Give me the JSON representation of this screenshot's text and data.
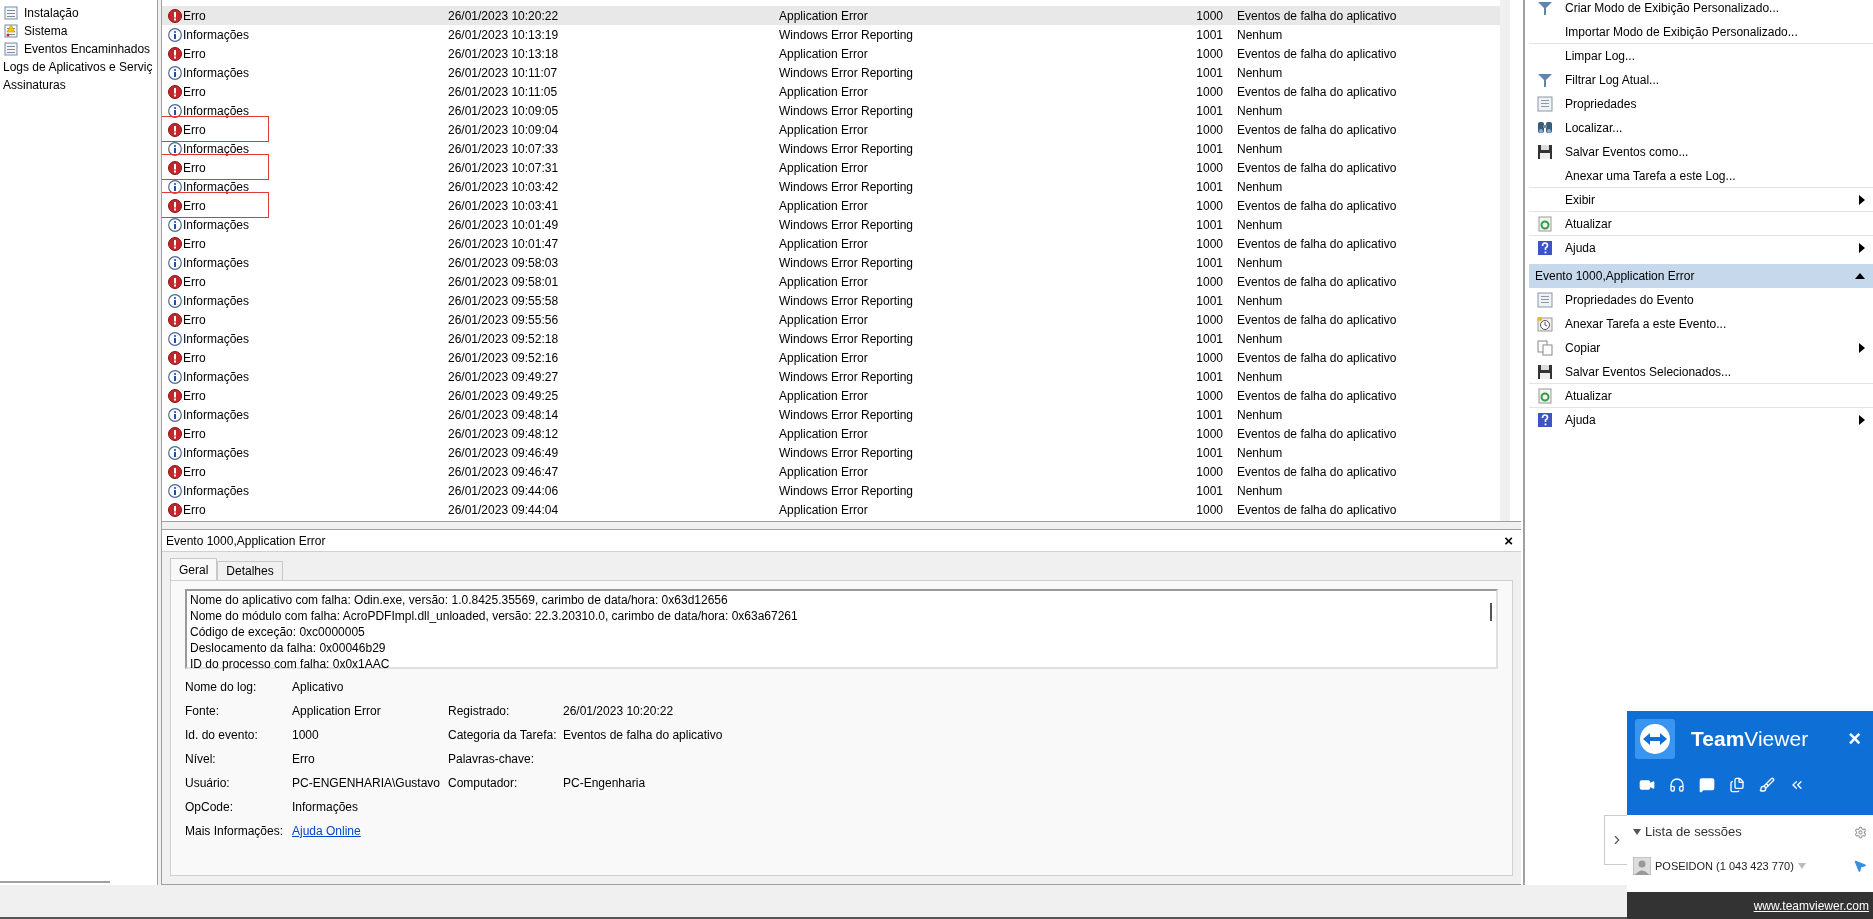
{
  "sidebar": {
    "log_items": [
      {
        "label": "Instalação",
        "kind": "log"
      },
      {
        "label": "Sistema",
        "kind": "warning_log"
      },
      {
        "label": "Eventos Encaminhados",
        "kind": "log"
      }
    ],
    "items": [
      {
        "label": "Logs de Aplicativos e Serviç"
      },
      {
        "label": "Assinaturas"
      }
    ]
  },
  "events": {
    "rows": [
      {
        "kind": "error",
        "level": "Erro",
        "date": "26/01/2023 10:20:22",
        "source": "Application Error",
        "id": "1000",
        "category": "Eventos de falha do aplicativo",
        "selected": true,
        "highlighted": false
      },
      {
        "kind": "info",
        "level": "Informações",
        "date": "26/01/2023 10:13:19",
        "source": "Windows Error Reporting",
        "id": "1001",
        "category": "Nenhum",
        "selected": false,
        "highlighted": false
      },
      {
        "kind": "error",
        "level": "Erro",
        "date": "26/01/2023 10:13:18",
        "source": "Application Error",
        "id": "1000",
        "category": "Eventos de falha do aplicativo",
        "selected": false,
        "highlighted": false
      },
      {
        "kind": "info",
        "level": "Informações",
        "date": "26/01/2023 10:11:07",
        "source": "Windows Error Reporting",
        "id": "1001",
        "category": "Nenhum",
        "selected": false,
        "highlighted": false
      },
      {
        "kind": "error",
        "level": "Erro",
        "date": "26/01/2023 10:11:05",
        "source": "Application Error",
        "id": "1000",
        "category": "Eventos de falha do aplicativo",
        "selected": false,
        "highlighted": false
      },
      {
        "kind": "info",
        "level": "Informações",
        "date": "26/01/2023 10:09:05",
        "source": "Windows Error Reporting",
        "id": "1001",
        "category": "Nenhum",
        "selected": false,
        "highlighted": false
      },
      {
        "kind": "error",
        "level": "Erro",
        "date": "26/01/2023 10:09:04",
        "source": "Application Error",
        "id": "1000",
        "category": "Eventos de falha do aplicativo",
        "selected": false,
        "highlighted": true
      },
      {
        "kind": "info",
        "level": "Informações",
        "date": "26/01/2023 10:07:33",
        "source": "Windows Error Reporting",
        "id": "1001",
        "category": "Nenhum",
        "selected": false,
        "highlighted": false
      },
      {
        "kind": "error",
        "level": "Erro",
        "date": "26/01/2023 10:07:31",
        "source": "Application Error",
        "id": "1000",
        "category": "Eventos de falha do aplicativo",
        "selected": false,
        "highlighted": true
      },
      {
        "kind": "info",
        "level": "Informações",
        "date": "26/01/2023 10:03:42",
        "source": "Windows Error Reporting",
        "id": "1001",
        "category": "Nenhum",
        "selected": false,
        "highlighted": false
      },
      {
        "kind": "error",
        "level": "Erro",
        "date": "26/01/2023 10:03:41",
        "source": "Application Error",
        "id": "1000",
        "category": "Eventos de falha do aplicativo",
        "selected": false,
        "highlighted": true
      },
      {
        "kind": "info",
        "level": "Informações",
        "date": "26/01/2023 10:01:49",
        "source": "Windows Error Reporting",
        "id": "1001",
        "category": "Nenhum",
        "selected": false,
        "highlighted": false
      },
      {
        "kind": "error",
        "level": "Erro",
        "date": "26/01/2023 10:01:47",
        "source": "Application Error",
        "id": "1000",
        "category": "Eventos de falha do aplicativo",
        "selected": false,
        "highlighted": false
      },
      {
        "kind": "info",
        "level": "Informações",
        "date": "26/01/2023 09:58:03",
        "source": "Windows Error Reporting",
        "id": "1001",
        "category": "Nenhum",
        "selected": false,
        "highlighted": false
      },
      {
        "kind": "error",
        "level": "Erro",
        "date": "26/01/2023 09:58:01",
        "source": "Application Error",
        "id": "1000",
        "category": "Eventos de falha do aplicativo",
        "selected": false,
        "highlighted": false
      },
      {
        "kind": "info",
        "level": "Informações",
        "date": "26/01/2023 09:55:58",
        "source": "Windows Error Reporting",
        "id": "1001",
        "category": "Nenhum",
        "selected": false,
        "highlighted": false
      },
      {
        "kind": "error",
        "level": "Erro",
        "date": "26/01/2023 09:55:56",
        "source": "Application Error",
        "id": "1000",
        "category": "Eventos de falha do aplicativo",
        "selected": false,
        "highlighted": false
      },
      {
        "kind": "info",
        "level": "Informações",
        "date": "26/01/2023 09:52:18",
        "source": "Windows Error Reporting",
        "id": "1001",
        "category": "Nenhum",
        "selected": false,
        "highlighted": false
      },
      {
        "kind": "error",
        "level": "Erro",
        "date": "26/01/2023 09:52:16",
        "source": "Application Error",
        "id": "1000",
        "category": "Eventos de falha do aplicativo",
        "selected": false,
        "highlighted": false
      },
      {
        "kind": "info",
        "level": "Informações",
        "date": "26/01/2023 09:49:27",
        "source": "Windows Error Reporting",
        "id": "1001",
        "category": "Nenhum",
        "selected": false,
        "highlighted": false
      },
      {
        "kind": "error",
        "level": "Erro",
        "date": "26/01/2023 09:49:25",
        "source": "Application Error",
        "id": "1000",
        "category": "Eventos de falha do aplicativo",
        "selected": false,
        "highlighted": false
      },
      {
        "kind": "info",
        "level": "Informações",
        "date": "26/01/2023 09:48:14",
        "source": "Windows Error Reporting",
        "id": "1001",
        "category": "Nenhum",
        "selected": false,
        "highlighted": false
      },
      {
        "kind": "error",
        "level": "Erro",
        "date": "26/01/2023 09:48:12",
        "source": "Application Error",
        "id": "1000",
        "category": "Eventos de falha do aplicativo",
        "selected": false,
        "highlighted": false
      },
      {
        "kind": "info",
        "level": "Informações",
        "date": "26/01/2023 09:46:49",
        "source": "Windows Error Reporting",
        "id": "1001",
        "category": "Nenhum",
        "selected": false,
        "highlighted": false
      },
      {
        "kind": "error",
        "level": "Erro",
        "date": "26/01/2023 09:46:47",
        "source": "Application Error",
        "id": "1000",
        "category": "Eventos de falha do aplicativo",
        "selected": false,
        "highlighted": false
      },
      {
        "kind": "info",
        "level": "Informações",
        "date": "26/01/2023 09:44:06",
        "source": "Windows Error Reporting",
        "id": "1001",
        "category": "Nenhum",
        "selected": false,
        "highlighted": false
      },
      {
        "kind": "error",
        "level": "Erro",
        "date": "26/01/2023 09:44:04",
        "source": "Application Error",
        "id": "1000",
        "category": "Eventos de falha do aplicativo",
        "selected": false,
        "highlighted": false
      }
    ]
  },
  "details": {
    "title": "Evento 1000,Application Error",
    "close": "×",
    "tabs": [
      {
        "label": "Geral",
        "selected": true
      },
      {
        "label": "Detalhes",
        "selected": false
      }
    ],
    "description": [
      "Nome do aplicativo com falha: Odin.exe, versão: 1.0.8425.35569, carimbo de data/hora: 0x63d12656",
      "Nome do módulo com falha: AcroPDFImpl.dll_unloaded, versão: 22.3.20310.0, carimbo de data/hora: 0x63a67261",
      "Código de exceção: 0xc0000005",
      "Deslocamento da falha: 0x00046b29",
      "ID do processo com falha: 0x0x1AAC"
    ],
    "fields": [
      {
        "label": "Nome do log:",
        "value": "Aplicativo"
      },
      {
        "label": "Fonte:",
        "value": "Application Error",
        "label2": "Registrado:",
        "value2": "26/01/2023 10:20:22"
      },
      {
        "label": "Id. do evento:",
        "value": "1000",
        "label2": "Categoria da Tarefa:",
        "value2": "Eventos de falha do aplicativo"
      },
      {
        "label": "Nível:",
        "value": "Erro",
        "label2": "Palavras-chave:"
      },
      {
        "label": "Usuário:",
        "value": "PC-ENGENHARIA\\Gustavo",
        "label2": "Computador:",
        "value2": "PC-Engenharia"
      },
      {
        "label": "OpCode:",
        "value": "Informações"
      },
      {
        "label": "Mais Informações:",
        "link": "Ajuda Online"
      }
    ]
  },
  "actions": {
    "items": [
      {
        "label": "Criar Modo de Exibição Personalizado...",
        "submenu": false
      },
      {
        "label": "Importar Modo de Exibição Personalizado...",
        "submenu": false
      },
      {
        "label": "Limpar Log...",
        "submenu": false
      },
      {
        "label": "Filtrar Log Atual...",
        "submenu": false
      },
      {
        "label": "Propriedades",
        "submenu": false
      },
      {
        "label": "Localizar...",
        "submenu": false
      },
      {
        "label": "Salvar Eventos como...",
        "submenu": false
      },
      {
        "label": "Anexar uma Tarefa a este Log...",
        "submenu": false
      },
      {
        "label": "Exibir",
        "submenu": true
      },
      {
        "label": "Atualizar",
        "submenu": false
      },
      {
        "label": "Ajuda",
        "submenu": true
      }
    ],
    "section_title": "Evento 1000,Application Error",
    "event_items": [
      {
        "label": "Propriedades do Evento",
        "submenu": false
      },
      {
        "label": "Anexar Tarefa a este Evento...",
        "submenu": false
      },
      {
        "label": "Copiar",
        "submenu": true
      },
      {
        "label": "Salvar Eventos Selecionados...",
        "submenu": false
      },
      {
        "label": "Atualizar",
        "submenu": false
      },
      {
        "label": "Ajuda",
        "submenu": true
      }
    ]
  },
  "teamviewer": {
    "title": "**Team**Viewer",
    "close": "×",
    "sessions_label": "Lista de sessões",
    "session": "POSEIDON (1 043 423 770)",
    "footer_link": "www.teamviewer.com"
  }
}
